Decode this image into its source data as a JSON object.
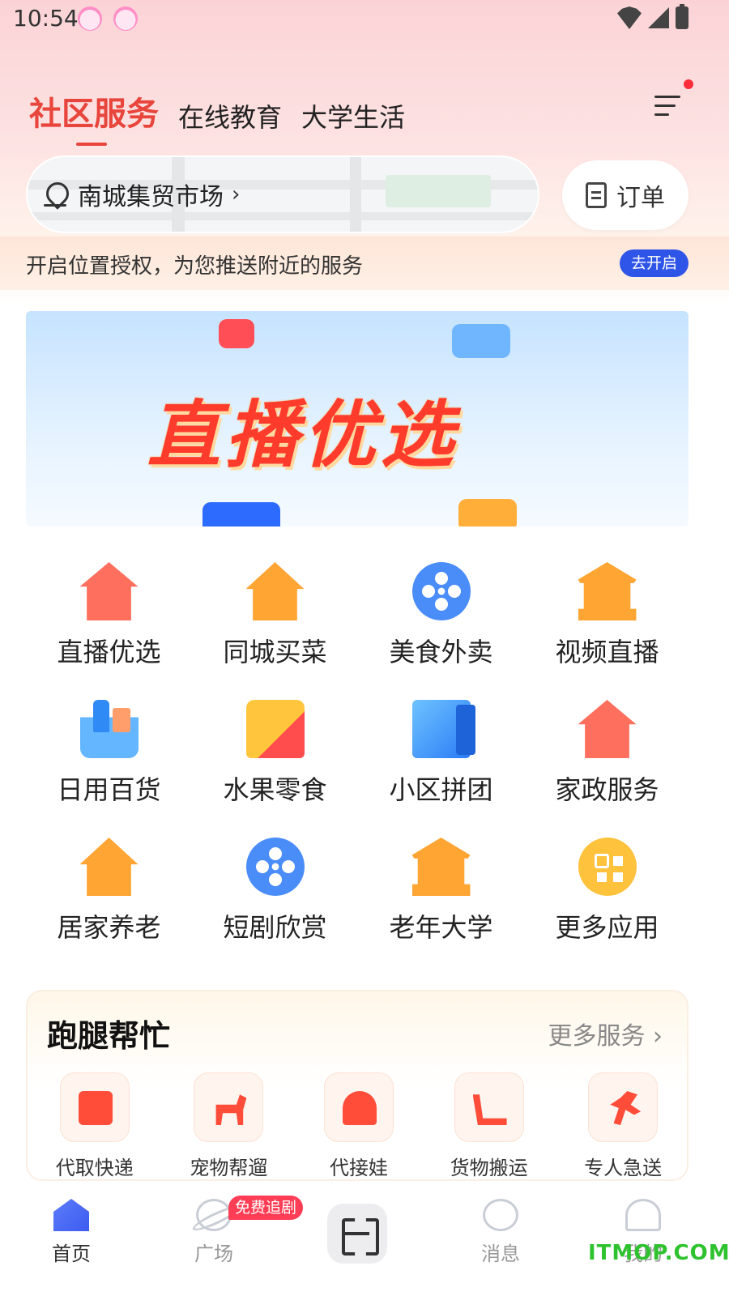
{
  "status_bar": {
    "time": "10:54"
  },
  "tabs": [
    {
      "label": "社区服务",
      "active": true
    },
    {
      "label": "在线教育",
      "active": false
    },
    {
      "label": "大学生活",
      "active": false
    }
  ],
  "location": {
    "name": "南城集贸市场",
    "chevron": "›"
  },
  "order_button": {
    "label": "订单"
  },
  "permission_bar": {
    "text": "开启位置授权，为您推送附近的服务",
    "button": "去开启"
  },
  "banner": {
    "title": "直播优选"
  },
  "apps": [
    {
      "label": "直播优选",
      "icon": "house-broom-icon"
    },
    {
      "label": "同城买菜",
      "icon": "house-elder-icon"
    },
    {
      "label": "美食外卖",
      "icon": "film-reel-icon"
    },
    {
      "label": "视频直播",
      "icon": "bank-building-icon"
    },
    {
      "label": "日用百货",
      "icon": "basket-icon"
    },
    {
      "label": "水果零食",
      "icon": "chips-icon"
    },
    {
      "label": "小区拼团",
      "icon": "building-icon"
    },
    {
      "label": "家政服务",
      "icon": "house-broom-icon"
    },
    {
      "label": "居家养老",
      "icon": "house-elder-icon"
    },
    {
      "label": "短剧欣赏",
      "icon": "film-reel-icon"
    },
    {
      "label": "老年大学",
      "icon": "bank-building-icon"
    },
    {
      "label": "更多应用",
      "icon": "grid-icon"
    }
  ],
  "errand": {
    "title": "跑腿帮忙",
    "more": "更多服务 ›",
    "items": [
      {
        "label": "代取快递",
        "icon": "parcel-icon"
      },
      {
        "label": "宠物帮遛",
        "icon": "dog-icon"
      },
      {
        "label": "代接娃",
        "icon": "parent-child-icon"
      },
      {
        "label": "货物搬运",
        "icon": "hand-truck-icon"
      },
      {
        "label": "专人急送",
        "icon": "runner-icon"
      }
    ]
  },
  "bottom_nav": {
    "items": [
      {
        "label": "首页",
        "icon": "home-icon",
        "active": true
      },
      {
        "label": "广场",
        "icon": "planet-icon",
        "active": false
      },
      {
        "label": "消息",
        "icon": "message-icon",
        "active": false
      },
      {
        "label": "我的",
        "icon": "user-icon",
        "active": false
      }
    ],
    "promo_badge": "免费追剧",
    "scan_icon": "scan-icon"
  },
  "watermark": "ITMOP.COM",
  "colors": {
    "accent_red": "#e8453c",
    "primary_blue": "#2f55e8",
    "orange": "#ffa534"
  }
}
